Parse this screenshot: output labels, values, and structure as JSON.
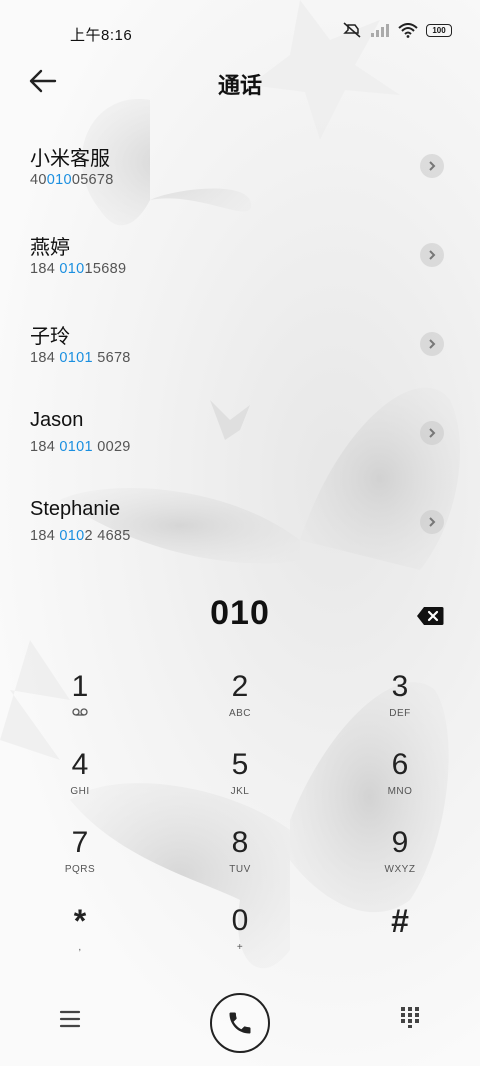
{
  "status_bar": {
    "time": "上午8:16",
    "battery": "100",
    "icons": [
      "mute-icon",
      "signal-icon",
      "wifi-icon",
      "battery-icon"
    ]
  },
  "header": {
    "title": "通话",
    "back_icon": "back-arrow-icon"
  },
  "contacts": [
    {
      "name": "小米客服",
      "num_pre": "40",
      "num_hl": "010",
      "num_post": "05678"
    },
    {
      "name": "燕婷",
      "num_pre": "184 ",
      "num_hl": "010",
      "num_post": "15689"
    },
    {
      "name": "子玲",
      "num_pre": "184 ",
      "num_hl": "0101",
      "num_post": " 5678"
    },
    {
      "name": "Jason",
      "num_pre": "184 ",
      "num_hl": "0101",
      "num_post": " 0029"
    },
    {
      "name": "Stephanie",
      "num_pre": "184 ",
      "num_hl": "010",
      "num_post": "2 4685"
    }
  ],
  "entry": {
    "digits": "010"
  },
  "keypad": [
    {
      "num": "1",
      "sub": "ᴼᴼ"
    },
    {
      "num": "2",
      "sub": "ABC"
    },
    {
      "num": "3",
      "sub": "DEF"
    },
    {
      "num": "4",
      "sub": "GHI"
    },
    {
      "num": "5",
      "sub": "JKL"
    },
    {
      "num": "6",
      "sub": "MNO"
    },
    {
      "num": "7",
      "sub": "PQRS"
    },
    {
      "num": "8",
      "sub": "TUV"
    },
    {
      "num": "9",
      "sub": "WXYZ"
    },
    {
      "num": "*",
      "sub": ","
    },
    {
      "num": "0",
      "sub": "+"
    },
    {
      "num": "#",
      "sub": ""
    }
  ],
  "colors": {
    "highlight": "#1a8fe0",
    "text": "#111111"
  }
}
